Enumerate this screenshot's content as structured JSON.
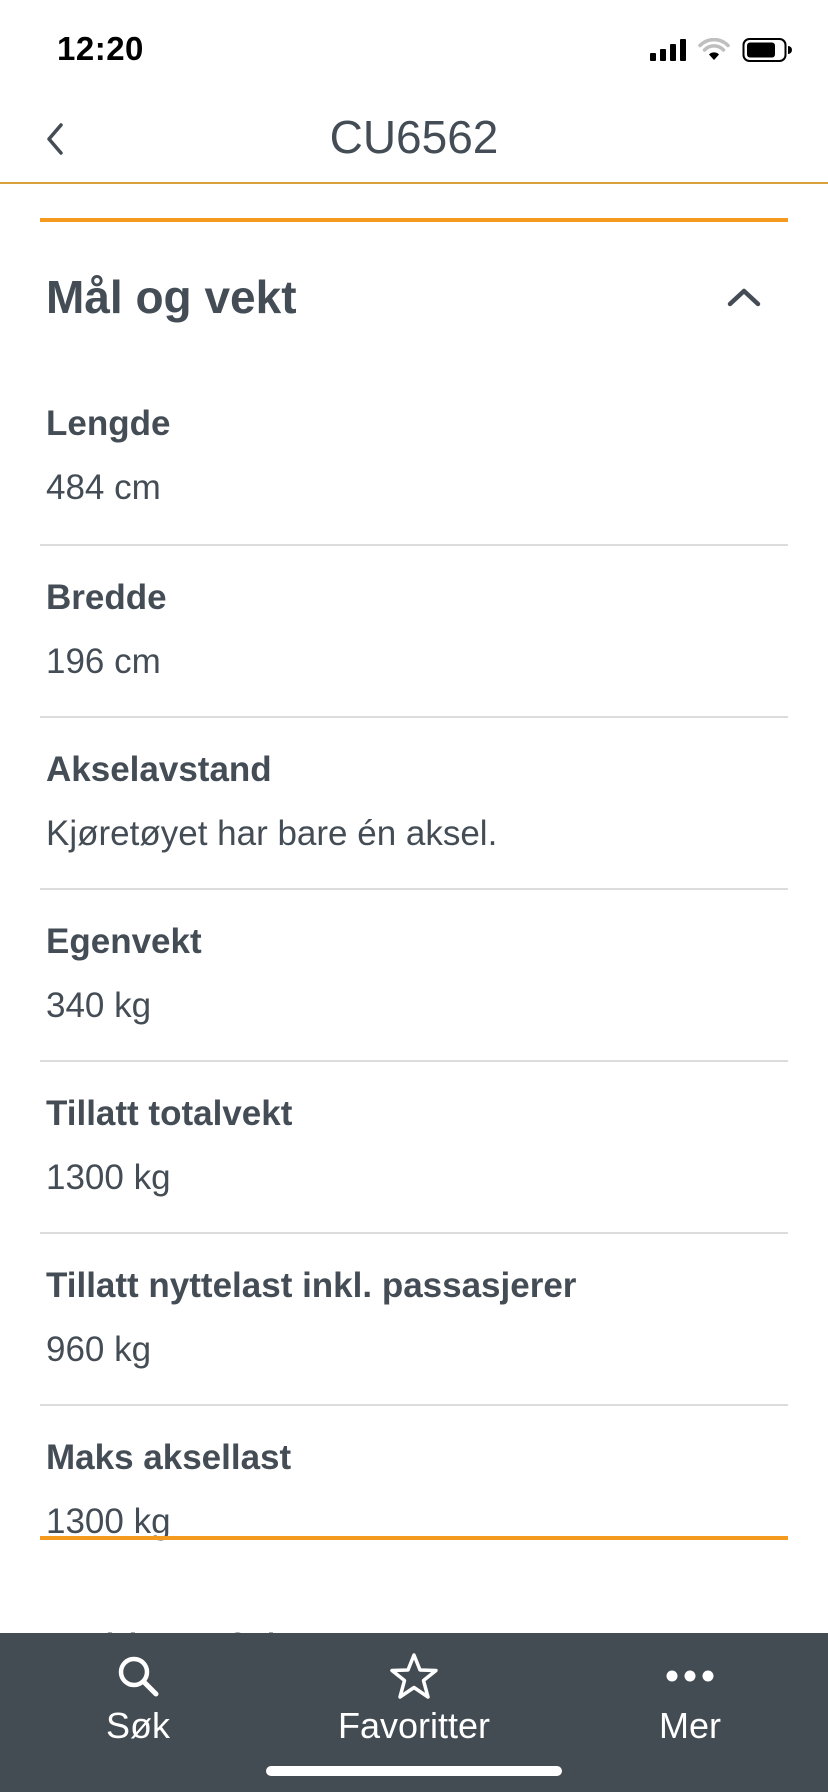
{
  "status_bar": {
    "time": "12:20",
    "icons": [
      "signal-icon",
      "wifi-icon",
      "battery-icon"
    ]
  },
  "nav": {
    "title": "CU6562",
    "back_icon": "chevron-left-icon"
  },
  "section": {
    "title": "Mål og vekt",
    "expanded": true,
    "fields": [
      {
        "label": "Lengde",
        "value": "484 cm"
      },
      {
        "label": "Bredde",
        "value": "196 cm"
      },
      {
        "label": "Akselavstand",
        "value": "Kjøretøyet har bare én aksel."
      },
      {
        "label": "Egenvekt",
        "value": "340 kg"
      },
      {
        "label": "Tillatt totalvekt",
        "value": "1300 kg"
      },
      {
        "label": "Tillatt nyttelast inkl. passasjerer",
        "value": "960 kg"
      },
      {
        "label": "Maks aksellast",
        "value": "1300 kg"
      }
    ]
  },
  "next_section": {
    "title": "Dekk og felg",
    "expanded": false
  },
  "tab_bar": {
    "tabs": [
      {
        "label": "Søk",
        "icon": "search-icon"
      },
      {
        "label": "Favoritter",
        "icon": "star-icon"
      },
      {
        "label": "Mer",
        "icon": "more-dots-icon"
      }
    ]
  },
  "colors": {
    "accent": "#f39a1f",
    "text": "#444d55",
    "tab_bar_bg": "#434c53",
    "divider": "#dcdcdc"
  }
}
